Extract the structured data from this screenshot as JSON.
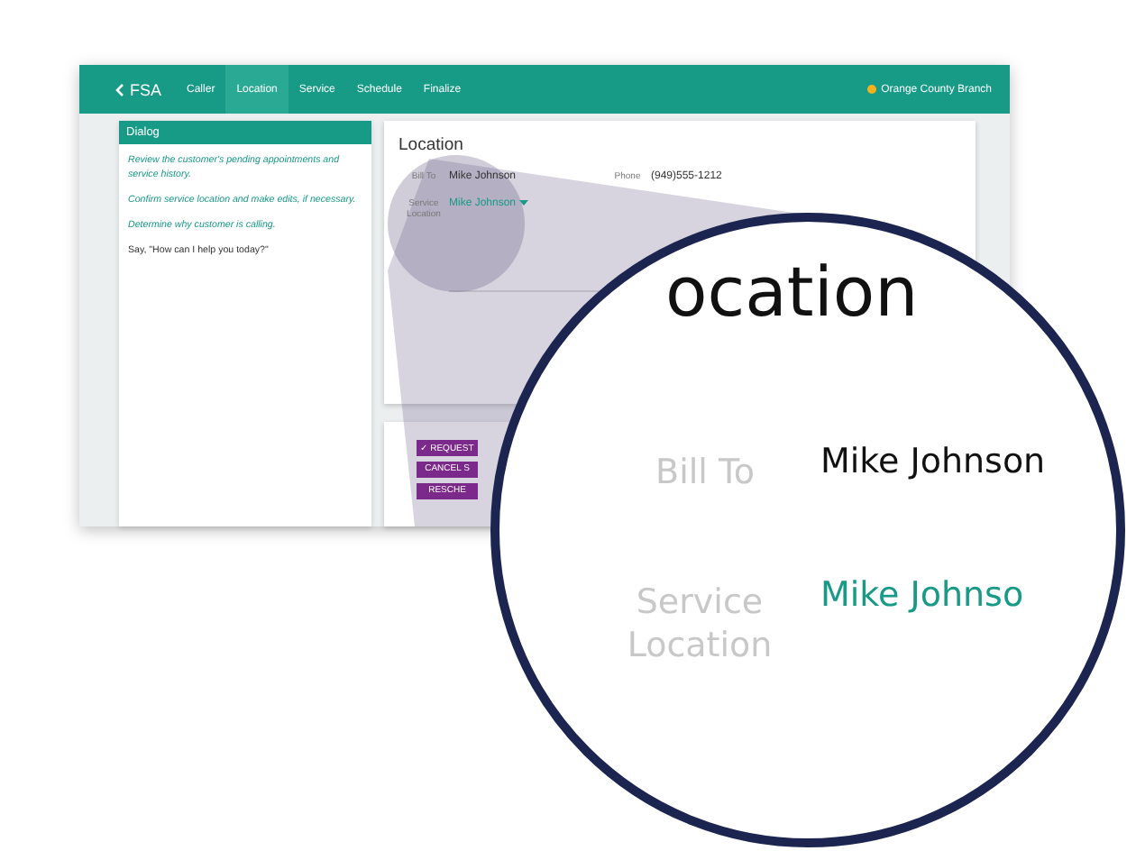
{
  "nav": {
    "back": "FSA",
    "tabs": [
      {
        "label": "Caller",
        "selected": false
      },
      {
        "label": "Location",
        "selected": true
      },
      {
        "label": "Service",
        "selected": false
      },
      {
        "label": "Schedule",
        "selected": false
      },
      {
        "label": "Finalize",
        "selected": false
      }
    ],
    "branch": "Orange County Branch"
  },
  "dialog": {
    "title": "Dialog",
    "lines": [
      {
        "text": "Review the customer's pending appointments and service history.",
        "kind": "instruction"
      },
      {
        "text": "Confirm service location and make edits, if necessary.",
        "kind": "instruction"
      },
      {
        "text": "Determine why customer is calling.",
        "kind": "instruction"
      },
      {
        "text": "Say, \"How can I help you today?\"",
        "kind": "say"
      }
    ]
  },
  "location_card": {
    "title": "Location",
    "fields": [
      {
        "label": "Bill To",
        "value": "Mike Johnson",
        "kind": "text"
      },
      {
        "label": "Service Location",
        "value": "Mike Johnson",
        "kind": "dropdown"
      }
    ],
    "phone": {
      "label": "Phone",
      "value": "(949)555-1212"
    }
  },
  "actions": [
    "✓ REQUEST",
    "CANCEL S",
    "RESCHE"
  ],
  "magnifier": {
    "heading": "ocation",
    "fields": [
      {
        "label": "Bill To",
        "value": "Mike Johnson",
        "kind": "text"
      },
      {
        "label": "Service Location",
        "value": "Mike Johnso",
        "kind": "link"
      }
    ]
  }
}
